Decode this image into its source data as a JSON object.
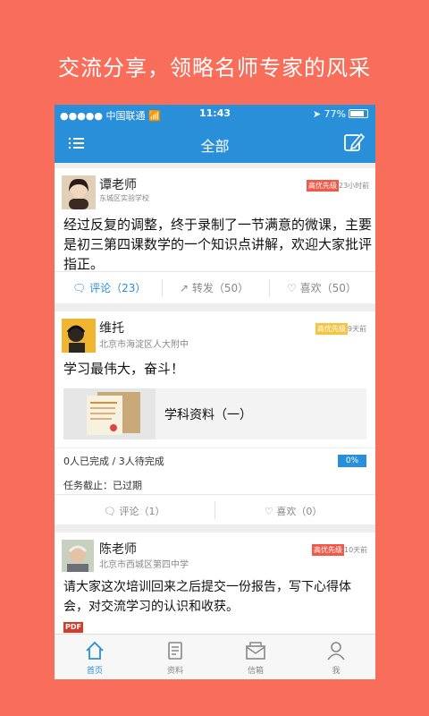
{
  "headline": "交流分享，领略名师专家的风采",
  "status": {
    "carrier": "中国联通",
    "time": "11:43",
    "battery": "77%"
  },
  "nav": {
    "title": "全部",
    "menu_icon": "list-icon",
    "edit_icon": "edit-icon"
  },
  "posts": [
    {
      "author": "谭老师",
      "school": "东城区实验学校",
      "badge": "高优先级",
      "ago": "23小时前",
      "content": "经过反复的调整，终于录制了一节满意的微课，主要是初三第四课数学的一个知识点讲解，欢迎大家批评指正。",
      "comment": "评论（23）",
      "repost": "转发（50）",
      "like": "喜欢（50）"
    },
    {
      "author": "维托",
      "school": "北京市海淀区人大附中",
      "badge": "高优先级",
      "ago": "9天前",
      "content": "学习最伟大，奋斗！",
      "attachment": "学科资料（一）",
      "progress_text": "0人已完成 / 3人待完成",
      "progress_value": "0%",
      "deadline": "任务截止：已过期",
      "comment": "评论（1）",
      "like": "喜欢（0）"
    },
    {
      "author": "陈老师",
      "school": "北京市西城区第四中学",
      "badge": "高优先级",
      "ago": "10天前",
      "content": "请大家这次培训回来之后提交一份报告，写下心得体会，对交流学习的认识和收获。",
      "file_tag": "PDF"
    }
  ],
  "tabs": [
    {
      "label": "首页",
      "icon": "home-icon",
      "active": true
    },
    {
      "label": "资料",
      "icon": "document-icon",
      "active": false
    },
    {
      "label": "信箱",
      "icon": "mailbox-icon",
      "active": false
    },
    {
      "label": "我",
      "icon": "profile-icon",
      "active": false
    }
  ],
  "colors": {
    "background": "#f96e5a",
    "primary": "#2a8fd9",
    "badge_red": "#f05a4a",
    "badge_yellow": "#f5c542"
  }
}
